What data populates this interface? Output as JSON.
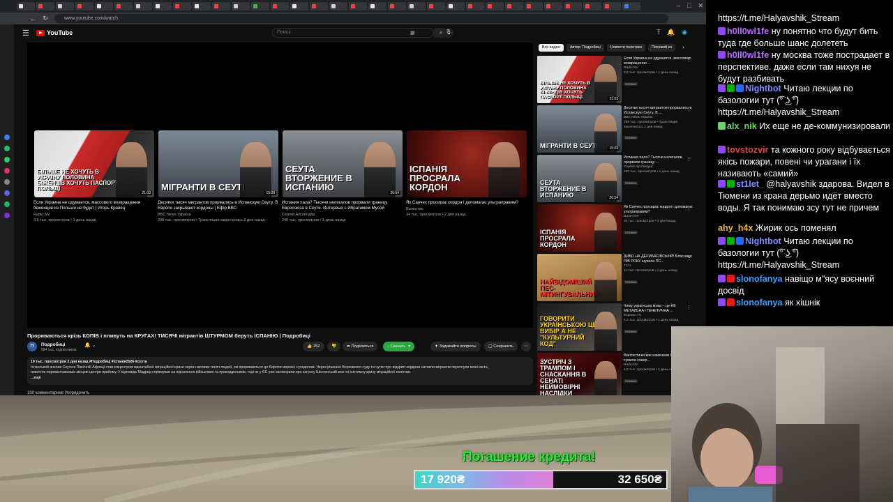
{
  "browser": {
    "url": "www.youtube.com/watch",
    "tab_colors": [
      "#e5e5e5",
      "#ff4040",
      "#d0d0d0",
      "#ff4040",
      "#e5e5e5",
      "#ff4040",
      "#d0d0d0",
      "#e5e5e5",
      "#ff4040",
      "#e5e5e5",
      "#ff4040",
      "#d0d0d0",
      "#4caf50",
      "#ff4040",
      "#e5e5e5",
      "#ff4040",
      "#d0d0d0",
      "#ff4040",
      "#e5e5e5",
      "#ff4040",
      "#d0d0d0",
      "#ff4040",
      "#e5e5e5",
      "#ff4040",
      "#ff4040",
      "#ff4040",
      "#ff4040",
      "#ff4040",
      "#ff4040",
      "#ff4040",
      "#ff4040",
      "#3b82f6"
    ]
  },
  "sidebar_icon_colors": [
    "#3b82f6",
    "#22c55e",
    "#25d366",
    "#e1306c",
    "#888",
    "#5865f2",
    "#1db954",
    "#8a2be2"
  ],
  "youtube": {
    "logo": "YouTube",
    "search_placeholder": "Поиск",
    "end_cards": [
      {
        "title": "Если Украина не одумается, массового возвращения беженцев из Польши не будет | Игорь Кравец",
        "channel": "Radio NV",
        "stats": "3,6 тыс. просмотров • 1 день назад",
        "duration": "21:03",
        "thumb_text": "БІЛЬШЕ НЕ ХОЧУТЬ В УКРАЇНУ ПОЛОВИНА БІЖЕНЦІВ ХОЧУТЬ ПАСПОРТ ПОЛЬЩІ"
      },
      {
        "title": "Десятки тысяч мигрантов прорвались в Испанскую Сеуту. В Европе закрывают кордоны | Ефір BBC",
        "channel": "BBC News Україна",
        "stats": "298 тыс. просмотров • Трансляция закончилась 2 дня назад",
        "duration": "15:09",
        "thumb_text": "МІГРАНТИ В СЕУТІ"
      },
      {
        "title": "Испания пала? Тысячи нелегалов прорвали границу Евросоюза в Сеуте. Интервью с Ибрагимом Мусой",
        "channel": "Сергей Ауслендер",
        "stats": "240 тыс. просмотров • 1 день назад",
        "duration": "26:54",
        "thumb_text": "СЕУТА ВТОРЖЕНИЕ В ИСПАНИЮ"
      },
      {
        "title": "Як Санчес просирає кордон і допомагає ультраправим?",
        "channel": "Валентин",
        "stats": "34 тыс. просмотров • 2 дня назад",
        "duration": "",
        "thumb_text": "ІСПАНІЯ ПРОСРАЛА КОРДОН"
      }
    ],
    "video_title": "Прориваються крізь КОПІВ і пливуть на КРУГАХ! ТИСЯЧІ мігрантів ШТУРМОМ беруть ІСПАНІЮ | Подробиці",
    "channel": {
      "name": "Подробиці",
      "subs": "584 тыс. подписчиков",
      "avatar_letter": "П"
    },
    "actions": {
      "likes": "252",
      "share": "Поделиться",
      "download": "Скачать",
      "ask": "Задавайте вопросы",
      "save": "Сохранить"
    },
    "description": {
      "meta": "19 тыс. просмотров  2 дня назад  #Подробиці #іспанія2026 #сеута",
      "line1": "Іспанський анклав Сеута в Північній Африці став епіцентром масштабної міграційної кризи через напливи тисяч людей, які прориваються до Європи морем і суходолом. Через рішення Верховного суду та чутки про відкриті кордони натовпи мігрантів перетнули межі міста,",
      "line2": "повністю перевантаживши місцеві центри прийому. У відповідь Мадрид спрямував на підсилення військових та прикордонників, тоді як у ЄС уже заговорили про загрозу Шенгенській зоні та системну кризу міграційної політики.",
      "more": "...ещё"
    },
    "comments_label": "100 комментариев     Упорядочить",
    "chips": [
      "Все видео",
      "Автор: Подробиці",
      "Новости политики",
      "Похожий ко"
    ],
    "recs": [
      {
        "title": "Если Украина не одумается, массового возвращения ...",
        "channel": "Radio NV",
        "stats": "3,6 тыс. просмотров • 1 день назад",
        "badge": "Новинка",
        "duration": "21:03",
        "thumb_text": "БІЛЬШЕ НЕ ХОЧУТЬ В УКРАЇНУ ПОЛОВИНА БІЖЕНЦІВ ХОЧУТЬ ПАСПОРТ ПОЛЬЩІ"
      },
      {
        "title": "Десятки тысяч мигрантов прорвались в Испанскую Сеуту. В ...",
        "channel": "BBC News Україна",
        "stats": "298 тыс. просмотров • Трансляция закончилась 2 дня назад",
        "badge": "Новинка",
        "duration": "15:09",
        "thumb_text": "МІГРАНТИ В СЕУТІ"
      },
      {
        "title": "Испания пала? Тысячи нелегалов прорвали границу ...",
        "channel": "Сергей Ауслендер",
        "stats": "240 тыс. просмотров • 1 день назад",
        "badge": "Новинка",
        "duration": "26:54",
        "thumb_text": "СЕУТА ВТОРЖЕНИЕ В ИСПАНИЮ"
      },
      {
        "title": "Як Санчес просирає кордон і допомагає ультраправим?",
        "channel": "Валентин",
        "stats": "34 тыс. просмотров • 2 дня назад",
        "badge": "Новинка",
        "duration": "",
        "thumb_text": "ІСПАНІЯ ПРОСРАЛА КОРДОН"
      },
      {
        "title": "ДИВО НА ДЕРИБАСІВСЬКІЙ! Власниця ПІВ РОКУ шукала ПС...",
        "channel": "ТСН",
        "stats": "11 тыс. просмотров • 1 день назад",
        "badge": "Новинка",
        "duration": "",
        "thumb_text": "НАЙВІДОМІШИЙ ПЕС-МІТИНГУВАЛЬНИК!"
      },
      {
        "title": "Чому українська мова – це НЕ МЕТАЛЬНА і ГЕНЕТИЧНА ...",
        "channel": "Espreso.TV",
        "stats": "4,2 тыс. просмотров • 1 день назад",
        "badge": "Новинка",
        "duration": "",
        "thumb_text": "ГОВОРИТИ УКРАЇНСЬКОЮ ЦЕ ВИБІР А НЕ \"КУЛЬТУРНИЙ КОД\""
      },
      {
        "title": "Фантастические изменени США. Лумер сумела совер...",
        "channel": "Radio NV",
        "stats": "4,8 тыс. просмотров • 1 день назад",
        "badge": "Новинка",
        "duration": "",
        "thumb_text": "ЗУСТРІЧ З ТРАМПОМ І СНАСКАННЯ В СЕНАТІ НЕЙМОВІРНІ НАСЛІДКИ"
      }
    ]
  },
  "chat": [
    {
      "user": "",
      "color": "#ffffff",
      "badges": [],
      "text": "https://t.me/Halyavshik_Stream"
    },
    {
      "user": "h0ll0wl1fe",
      "color": "#b86eff",
      "badges": [
        "#9146ff"
      ],
      "text": "ну понятно что будут бить туда где больше шанс долететь"
    },
    {
      "user": "h0ll0wl1fe",
      "color": "#b86eff",
      "badges": [
        "#9146ff"
      ],
      "text": "ну москва тоже пострадает в перспективе. даже если там нихуя не будут разбивать"
    },
    {
      "user": "Nightbot",
      "color": "#7f8cff",
      "badges": [
        "#9146ff",
        "#00ad03",
        "#1e69ff"
      ],
      "text": "Читаю лекции по базологии тут (͡° ͜ʖ ͡°) https://t.me/Halyavshik_Stream"
    },
    {
      "user": "alx_nik",
      "color": "#6bd66b",
      "badges": [
        "#6bd66b"
      ],
      "text": "Их еще не де-коммунизировали"
    },
    {
      "user": "tovstozvir",
      "color": "#d94b4b",
      "badges": [
        "#9146ff"
      ],
      "text": "та кожного року відбувається якісь пожари, повені чи урагани і їх називають «самий»"
    },
    {
      "user": "st1let_",
      "color": "#7f8cff",
      "badges": [
        "#9146ff",
        "#00ad03"
      ],
      "text": "@halyavshik здарова. Видел в Тюмени из крана дерьмо идёт вместо воды. Я так понимаю зсу тут не причем"
    },
    {
      "user": "ahy_h4x",
      "color": "#e8b93a",
      "badges": [],
      "text": "Жирик ось поменял"
    },
    {
      "user": "Nightbot",
      "color": "#7f8cff",
      "badges": [
        "#9146ff",
        "#00ad03",
        "#1e69ff"
      ],
      "text": "Читаю лекции по базологии тут (͡° ͜ʖ ͡°) https://t.me/Halyavshik_Stream"
    },
    {
      "user": "slonofanya",
      "color": "#3aa0ff",
      "badges": [
        "#9146ff",
        "#e91916"
      ],
      "text": "навіщо м\"ясу воєнний досвід"
    },
    {
      "user": "slonofanya",
      "color": "#3aa0ff",
      "badges": [
        "#9146ff",
        "#e91916"
      ],
      "text": "як хішнік"
    }
  ],
  "overlay": {
    "promo": "Погашение кредита!",
    "goal_current": "17 920₴",
    "goal_total": "32 650₴",
    "goal_progress": 0.549
  }
}
